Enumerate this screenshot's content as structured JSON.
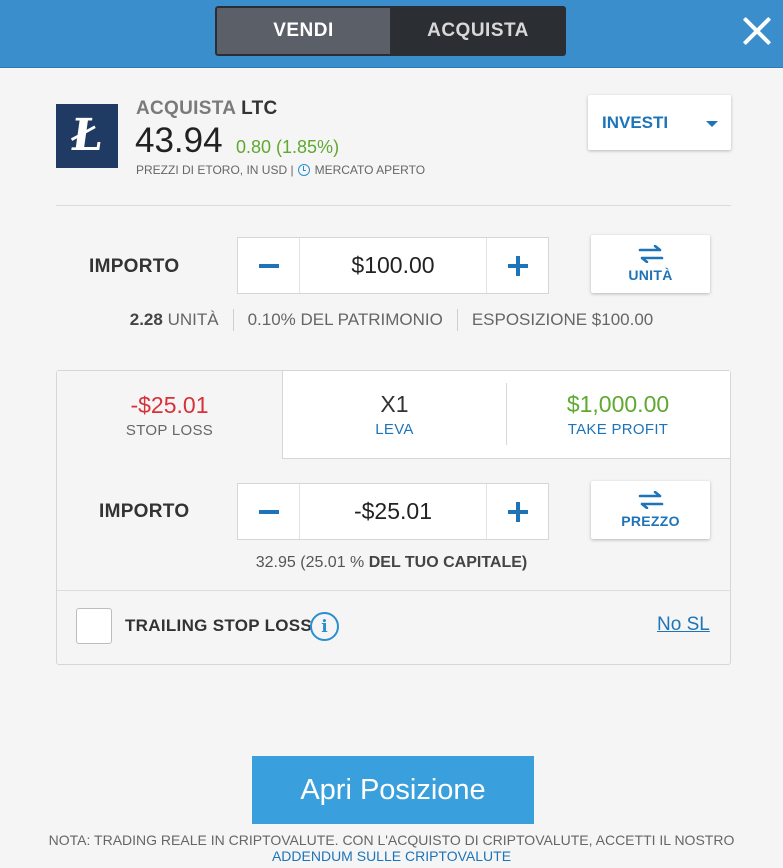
{
  "header": {
    "sell_label": "VENDI",
    "buy_label": "ACQUISTA"
  },
  "instrument": {
    "action": "ACQUISTA",
    "symbol": "LTC",
    "logo_letter": "Ł",
    "price": "43.94",
    "change": "0.80 (1.85%)",
    "price_source": "PREZZI DI ETORO, IN USD |",
    "market_status": "MERCATO APERTO"
  },
  "invest_dropdown": {
    "label": "INVESTI"
  },
  "amount": {
    "label": "IMPORTO",
    "value": "$100.00",
    "swap_label": "UNITÀ",
    "units_value": "2.28",
    "units_label": "UNITÀ",
    "equity": "0.10% DEL PATRIMONIO",
    "exposure_label": "ESPOSIZIONE",
    "exposure_value": "$100.00"
  },
  "risk": {
    "stop_loss": {
      "value": "-$25.01",
      "label": "STOP LOSS"
    },
    "leverage": {
      "value": "X1",
      "label": "LEVA"
    },
    "take_profit": {
      "value": "$1,000.00",
      "label": "TAKE PROFIT"
    },
    "amount_label": "IMPORTO",
    "amount_value": "-$25.01",
    "swap_label": "PREZZO",
    "capital_rate": "32.95",
    "capital_pct": "(25.01 %",
    "capital_text": "DEL TUO CAPITALE)",
    "trailing_label": "TRAILING STOP LOSS",
    "info_glyph": "i",
    "no_sl": "No SL"
  },
  "footer": {
    "open_button": "Apri Posizione",
    "note": "NOTA: TRADING REALE IN CRIPTOVALUTE. CON L'ACQUISTO DI CRIPTOVALUTE, ACCETTI IL NOSTRO",
    "note_link": "ADDENDUM SULLE CRIPTOVALUTE"
  },
  "colors": {
    "header_bg": "#3a8ecc",
    "accent": "#1e74b8",
    "positive": "#5fa92f",
    "negative": "#d8313a",
    "button_primary": "#3aa0dd"
  },
  "icons": [
    "close-icon",
    "litecoin-logo",
    "clock-icon",
    "chevron-down-icon",
    "minus-icon",
    "plus-icon",
    "swap-icon",
    "info-icon"
  ]
}
